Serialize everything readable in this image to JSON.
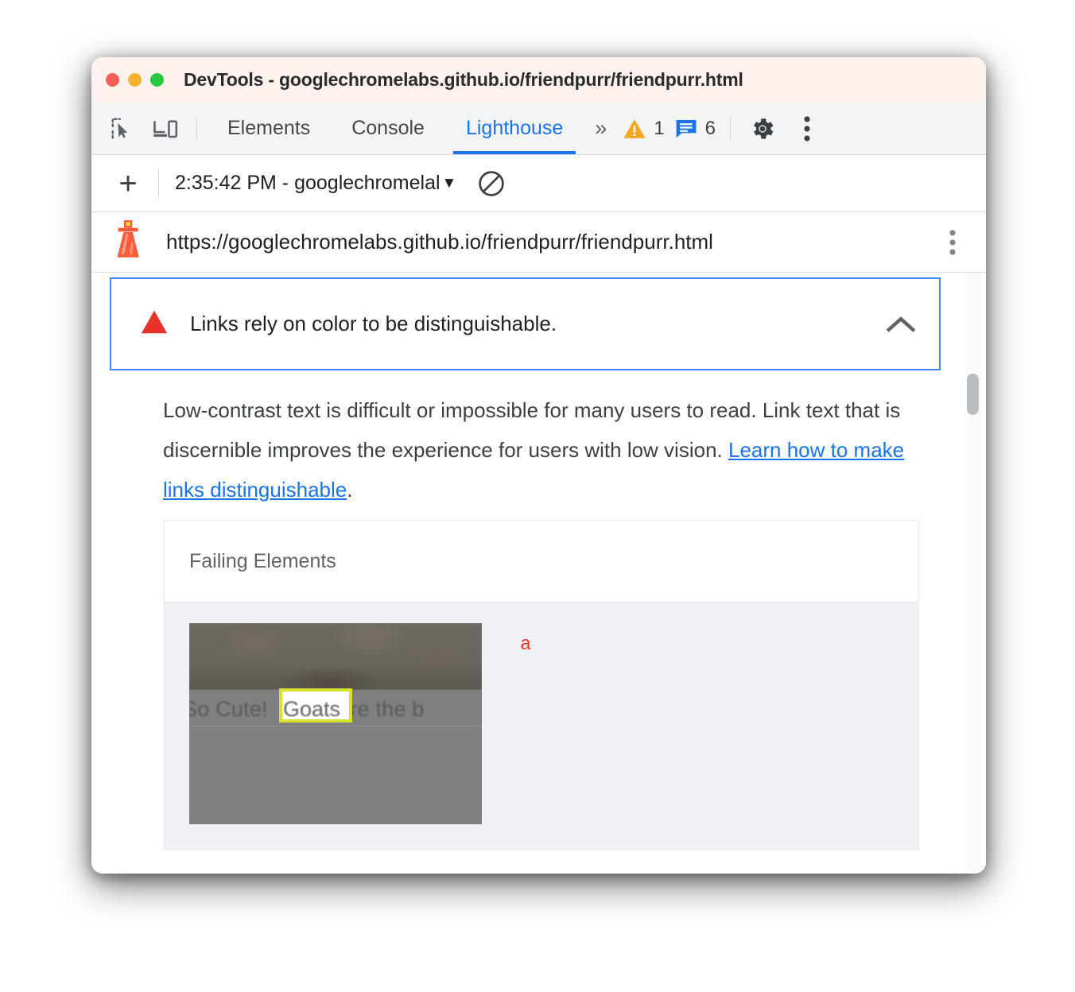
{
  "window": {
    "title": "DevTools - googlechromelabs.github.io/friendpurr/friendpurr.html",
    "traffic_lights": [
      {
        "name": "close",
        "color": "#fa5f57"
      },
      {
        "name": "minimize",
        "color": "#f2b231"
      },
      {
        "name": "maximize",
        "color": "#28c83f"
      }
    ]
  },
  "devtools_tabbar": {
    "icons": [
      {
        "name": "inspect-element-icon",
        "label": "Inspect element"
      },
      {
        "name": "device-toolbar-icon",
        "label": "Toggle device toolbar"
      }
    ],
    "tabs": [
      {
        "label": "Elements",
        "selected": false
      },
      {
        "label": "Console",
        "selected": false
      },
      {
        "label": "Lighthouse",
        "selected": true
      }
    ],
    "more_tabs_label": "»",
    "warning_count": "1",
    "info_count": "6",
    "settings_label": "Settings",
    "menu_label": "Customize and control DevTools",
    "accent_selected": "#1a73e8",
    "warning_color": "#f5a623",
    "info_color": "#1a73e8"
  },
  "lighthouse_toolbar": {
    "new_audit_label": "+",
    "run_selected": "2:35:42 PM - googlechromelal",
    "caret": "▼",
    "clear_label": "Clear all"
  },
  "url_bar": {
    "url": "https://googlechromelabs.github.io/friendpurr/friendpurr.html",
    "menu_label": "More options"
  },
  "report": {
    "audit": {
      "title": "Links rely on color to be distinguishable.",
      "severity": "fail",
      "severity_color": "#e8322a",
      "focus_border_color": "#4285f4",
      "collapse_label": "Collapse",
      "description_part1": "Low-contrast text is difficult or impossible for many users to read. Link text that is discernible improves the experience for users with low vision. ",
      "link_text": "Learn how to make links distinguishable",
      "description_part2": "."
    },
    "failing_elements": {
      "column_header": "Failing Elements",
      "rows": [
        {
          "thumbnail_text_before": "So Cute! ",
          "thumbnail_highlight_text": "Goats",
          "thumbnail_text_after": " are the b",
          "highlight_color": "#d8e02e",
          "selector": "a"
        }
      ]
    }
  }
}
